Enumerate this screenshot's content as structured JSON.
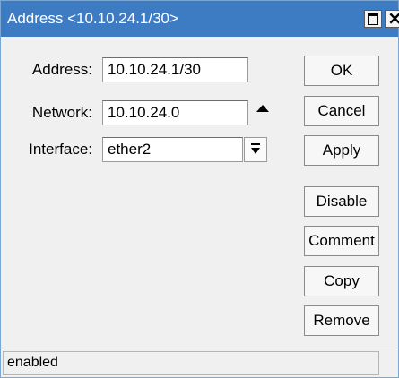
{
  "window": {
    "title": "Address <10.10.24.1/30>"
  },
  "form": {
    "address_label": "Address:",
    "address_value": "10.10.24.1/30",
    "network_label": "Network:",
    "network_value": "10.10.24.0",
    "interface_label": "Interface:",
    "interface_value": "ether2"
  },
  "buttons": {
    "ok": "OK",
    "cancel": "Cancel",
    "apply": "Apply",
    "disable": "Disable",
    "comment": "Comment",
    "copy": "Copy",
    "remove": "Remove"
  },
  "status": {
    "text": "enabled"
  },
  "icons": {
    "maximize": "maximize-icon",
    "close": "close-icon",
    "network_toggle": "triangle-up-icon",
    "interface_dropdown": "dropdown-arrow-icon"
  },
  "colors": {
    "titlebar": "#3d7bc3",
    "window_bg": "#f0f0f0"
  }
}
